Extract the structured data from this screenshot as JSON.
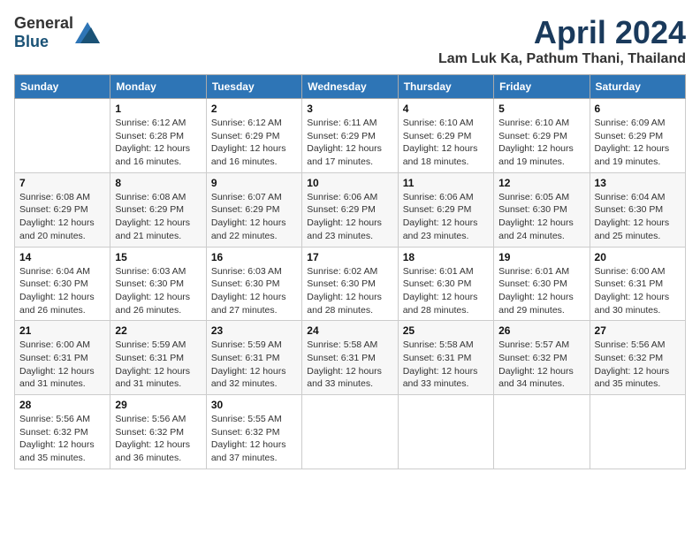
{
  "header": {
    "logo_general": "General",
    "logo_blue": "Blue",
    "title": "April 2024",
    "subtitle": "Lam Luk Ka, Pathum Thani, Thailand"
  },
  "weekdays": [
    "Sunday",
    "Monday",
    "Tuesday",
    "Wednesday",
    "Thursday",
    "Friday",
    "Saturday"
  ],
  "weeks": [
    [
      {
        "day": "",
        "info": ""
      },
      {
        "day": "1",
        "info": "Sunrise: 6:12 AM\nSunset: 6:28 PM\nDaylight: 12 hours and 16 minutes."
      },
      {
        "day": "2",
        "info": "Sunrise: 6:12 AM\nSunset: 6:29 PM\nDaylight: 12 hours and 16 minutes."
      },
      {
        "day": "3",
        "info": "Sunrise: 6:11 AM\nSunset: 6:29 PM\nDaylight: 12 hours and 17 minutes."
      },
      {
        "day": "4",
        "info": "Sunrise: 6:10 AM\nSunset: 6:29 PM\nDaylight: 12 hours and 18 minutes."
      },
      {
        "day": "5",
        "info": "Sunrise: 6:10 AM\nSunset: 6:29 PM\nDaylight: 12 hours and 19 minutes."
      },
      {
        "day": "6",
        "info": "Sunrise: 6:09 AM\nSunset: 6:29 PM\nDaylight: 12 hours and 19 minutes."
      }
    ],
    [
      {
        "day": "7",
        "info": "Sunrise: 6:08 AM\nSunset: 6:29 PM\nDaylight: 12 hours and 20 minutes."
      },
      {
        "day": "8",
        "info": "Sunrise: 6:08 AM\nSunset: 6:29 PM\nDaylight: 12 hours and 21 minutes."
      },
      {
        "day": "9",
        "info": "Sunrise: 6:07 AM\nSunset: 6:29 PM\nDaylight: 12 hours and 22 minutes."
      },
      {
        "day": "10",
        "info": "Sunrise: 6:06 AM\nSunset: 6:29 PM\nDaylight: 12 hours and 23 minutes."
      },
      {
        "day": "11",
        "info": "Sunrise: 6:06 AM\nSunset: 6:29 PM\nDaylight: 12 hours and 23 minutes."
      },
      {
        "day": "12",
        "info": "Sunrise: 6:05 AM\nSunset: 6:30 PM\nDaylight: 12 hours and 24 minutes."
      },
      {
        "day": "13",
        "info": "Sunrise: 6:04 AM\nSunset: 6:30 PM\nDaylight: 12 hours and 25 minutes."
      }
    ],
    [
      {
        "day": "14",
        "info": "Sunrise: 6:04 AM\nSunset: 6:30 PM\nDaylight: 12 hours and 26 minutes."
      },
      {
        "day": "15",
        "info": "Sunrise: 6:03 AM\nSunset: 6:30 PM\nDaylight: 12 hours and 26 minutes."
      },
      {
        "day": "16",
        "info": "Sunrise: 6:03 AM\nSunset: 6:30 PM\nDaylight: 12 hours and 27 minutes."
      },
      {
        "day": "17",
        "info": "Sunrise: 6:02 AM\nSunset: 6:30 PM\nDaylight: 12 hours and 28 minutes."
      },
      {
        "day": "18",
        "info": "Sunrise: 6:01 AM\nSunset: 6:30 PM\nDaylight: 12 hours and 28 minutes."
      },
      {
        "day": "19",
        "info": "Sunrise: 6:01 AM\nSunset: 6:30 PM\nDaylight: 12 hours and 29 minutes."
      },
      {
        "day": "20",
        "info": "Sunrise: 6:00 AM\nSunset: 6:31 PM\nDaylight: 12 hours and 30 minutes."
      }
    ],
    [
      {
        "day": "21",
        "info": "Sunrise: 6:00 AM\nSunset: 6:31 PM\nDaylight: 12 hours and 31 minutes."
      },
      {
        "day": "22",
        "info": "Sunrise: 5:59 AM\nSunset: 6:31 PM\nDaylight: 12 hours and 31 minutes."
      },
      {
        "day": "23",
        "info": "Sunrise: 5:59 AM\nSunset: 6:31 PM\nDaylight: 12 hours and 32 minutes."
      },
      {
        "day": "24",
        "info": "Sunrise: 5:58 AM\nSunset: 6:31 PM\nDaylight: 12 hours and 33 minutes."
      },
      {
        "day": "25",
        "info": "Sunrise: 5:58 AM\nSunset: 6:31 PM\nDaylight: 12 hours and 33 minutes."
      },
      {
        "day": "26",
        "info": "Sunrise: 5:57 AM\nSunset: 6:32 PM\nDaylight: 12 hours and 34 minutes."
      },
      {
        "day": "27",
        "info": "Sunrise: 5:56 AM\nSunset: 6:32 PM\nDaylight: 12 hours and 35 minutes."
      }
    ],
    [
      {
        "day": "28",
        "info": "Sunrise: 5:56 AM\nSunset: 6:32 PM\nDaylight: 12 hours and 35 minutes."
      },
      {
        "day": "29",
        "info": "Sunrise: 5:56 AM\nSunset: 6:32 PM\nDaylight: 12 hours and 36 minutes."
      },
      {
        "day": "30",
        "info": "Sunrise: 5:55 AM\nSunset: 6:32 PM\nDaylight: 12 hours and 37 minutes."
      },
      {
        "day": "",
        "info": ""
      },
      {
        "day": "",
        "info": ""
      },
      {
        "day": "",
        "info": ""
      },
      {
        "day": "",
        "info": ""
      }
    ]
  ]
}
